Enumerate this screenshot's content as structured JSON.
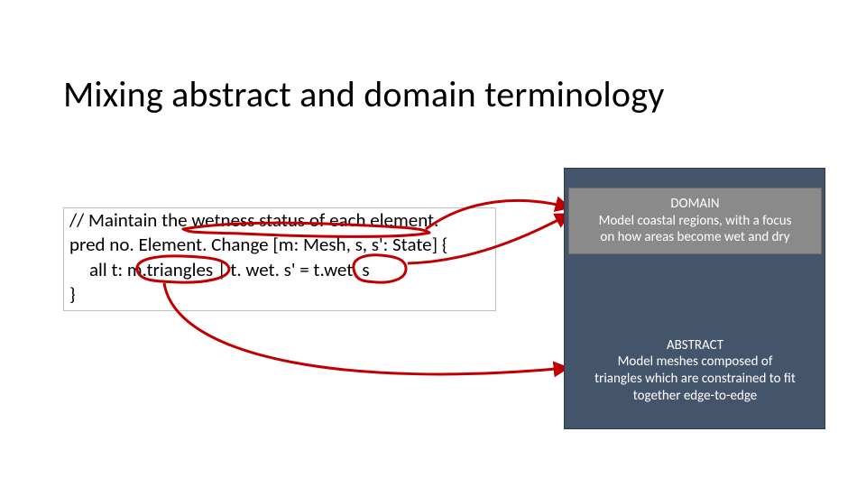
{
  "title": "Mixing abstract and domain terminology",
  "code": {
    "line1": {
      "a": "// Maintain the ",
      "b": "wetness",
      "c": " status of each element."
    },
    "line2": {
      "a": "pred no. Element. Change [m: Mesh, ",
      "b": "s, s'",
      "c": ": State] {"
    },
    "line3": {
      "a": "all t: m.",
      "b": "triangles",
      "c": " | t. wet. s' = t.",
      "d": "wet",
      "e": ". s"
    },
    "line4": "}"
  },
  "panel": {
    "domain": {
      "heading": "DOMAIN",
      "line1": "Model coastal regions, with a focus",
      "line2": "on how areas become wet and dry"
    },
    "abstract": {
      "heading": "ABSTRACT",
      "line1": "Model meshes composed of",
      "line2": "triangles which are constrained to fit",
      "line3": "together edge-to-edge"
    }
  },
  "colors": {
    "annotation_red": "#c00000",
    "panel_bg": "#44546a",
    "domain_card_bg": "#8a8a8a"
  }
}
